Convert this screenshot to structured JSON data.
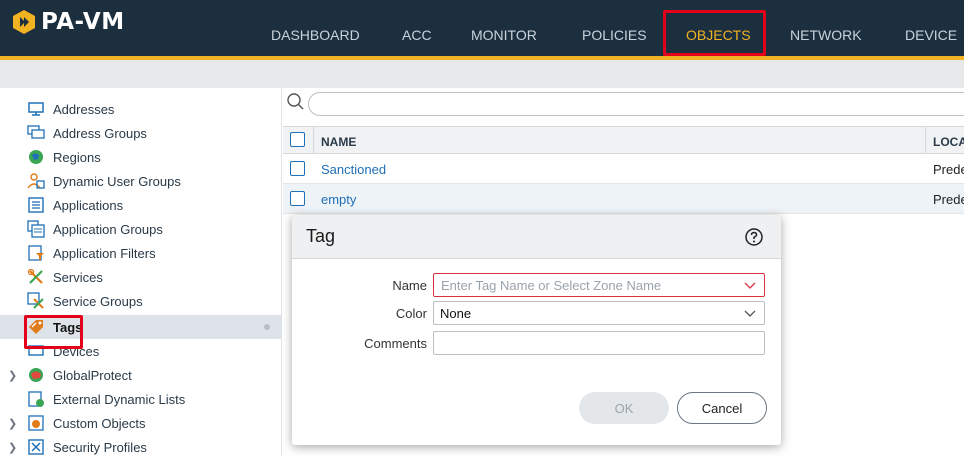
{
  "app": {
    "brand": "PA-VM"
  },
  "nav": {
    "tabs": [
      {
        "label": "DASHBOARD",
        "active": false
      },
      {
        "label": "ACC",
        "active": false
      },
      {
        "label": "MONITOR",
        "active": false
      },
      {
        "label": "POLICIES",
        "active": false
      },
      {
        "label": "OBJECTS",
        "active": true
      },
      {
        "label": "NETWORK",
        "active": false
      },
      {
        "label": "DEVICE",
        "active": false
      }
    ]
  },
  "sidebar": {
    "items": [
      {
        "label": "Addresses",
        "icon": "addresses-icon"
      },
      {
        "label": "Address Groups",
        "icon": "address-groups-icon"
      },
      {
        "label": "Regions",
        "icon": "regions-icon"
      },
      {
        "label": "Dynamic User Groups",
        "icon": "dynamic-user-groups-icon"
      },
      {
        "label": "Applications",
        "icon": "applications-icon"
      },
      {
        "label": "Application Groups",
        "icon": "application-groups-icon"
      },
      {
        "label": "Application Filters",
        "icon": "application-filters-icon"
      },
      {
        "label": "Services",
        "icon": "services-icon"
      },
      {
        "label": "Service Groups",
        "icon": "service-groups-icon"
      },
      {
        "label": "Tags",
        "icon": "tag-icon",
        "selected": true
      },
      {
        "label": "Devices",
        "icon": "devices-icon"
      },
      {
        "label": "GlobalProtect",
        "icon": "globalprotect-icon",
        "expandable": true
      },
      {
        "label": "External Dynamic Lists",
        "icon": "external-lists-icon"
      },
      {
        "label": "Custom Objects",
        "icon": "custom-objects-icon",
        "expandable": true
      },
      {
        "label": "Security Profiles",
        "icon": "security-profiles-icon",
        "expandable": true
      }
    ]
  },
  "table": {
    "headers": {
      "name": "NAME",
      "location": "LOCA"
    },
    "rows": [
      {
        "name": "Sanctioned",
        "location": "Prede"
      },
      {
        "name": "empty",
        "location": "Prede"
      }
    ]
  },
  "dialog": {
    "title": "Tag",
    "name_label": "Name",
    "name_placeholder": "Enter Tag Name or Select Zone Name",
    "color_label": "Color",
    "color_value": "None",
    "comments_label": "Comments",
    "comments_value": "",
    "ok_label": "OK",
    "cancel_label": "Cancel"
  },
  "colors": {
    "topbar": "#1b2f3f",
    "accent": "#f1b322",
    "highlight": "#e3001b",
    "link": "#1f6fb5"
  }
}
